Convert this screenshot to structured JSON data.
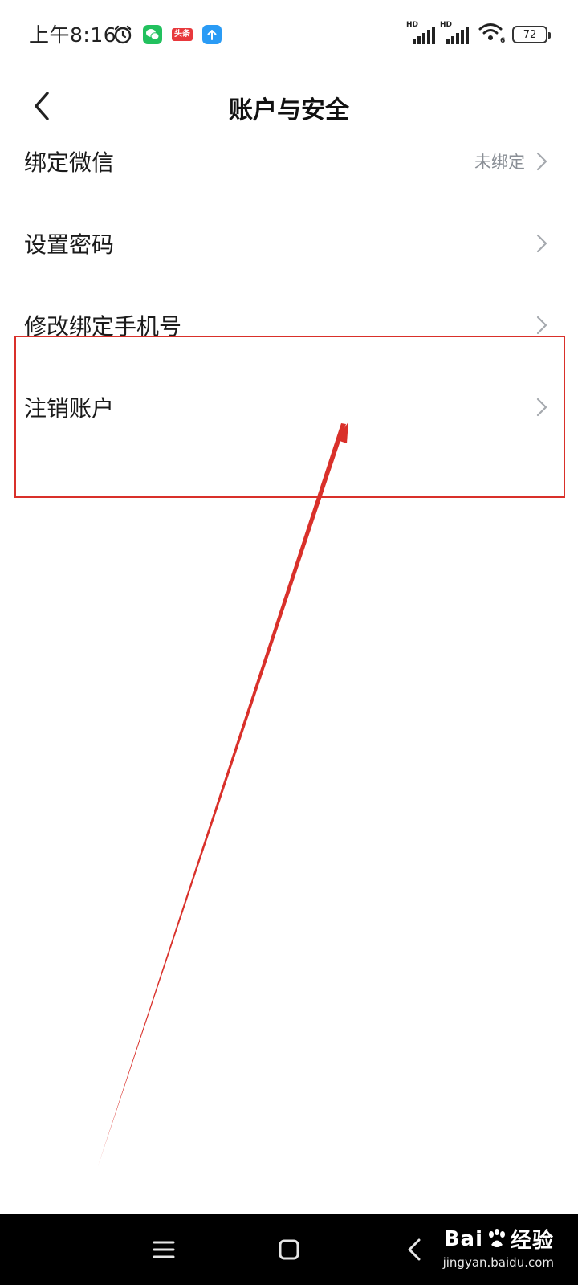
{
  "status_bar": {
    "time": "上午8:16",
    "toutiao_label": "头条",
    "signal_1_label": "HD",
    "signal_2_label": "HD",
    "wifi_badge": "6",
    "battery": "72",
    "icons": [
      "alarm-icon",
      "wechat-icon",
      "toutiao-icon",
      "upload-icon",
      "signal-icon",
      "wifi-icon",
      "battery-icon"
    ]
  },
  "header": {
    "title": "账户与安全",
    "back_icon": "chevron-left-icon"
  },
  "settings": {
    "items": [
      {
        "label": "绑定微信",
        "value": "未绑定"
      },
      {
        "label": "设置密码",
        "value": ""
      },
      {
        "label": "修改绑定手机号",
        "value": ""
      },
      {
        "label": "注销账户",
        "value": ""
      }
    ]
  },
  "annotation": {
    "color": "#d9302a",
    "highlighted_item": "注销账户"
  },
  "nav_bar": {
    "icons": [
      "menu-icon",
      "home-icon",
      "back-icon"
    ]
  },
  "watermark": {
    "logo_text_1": "Bai",
    "logo_text_2": "经验",
    "url": "jingyan.baidu.com"
  }
}
